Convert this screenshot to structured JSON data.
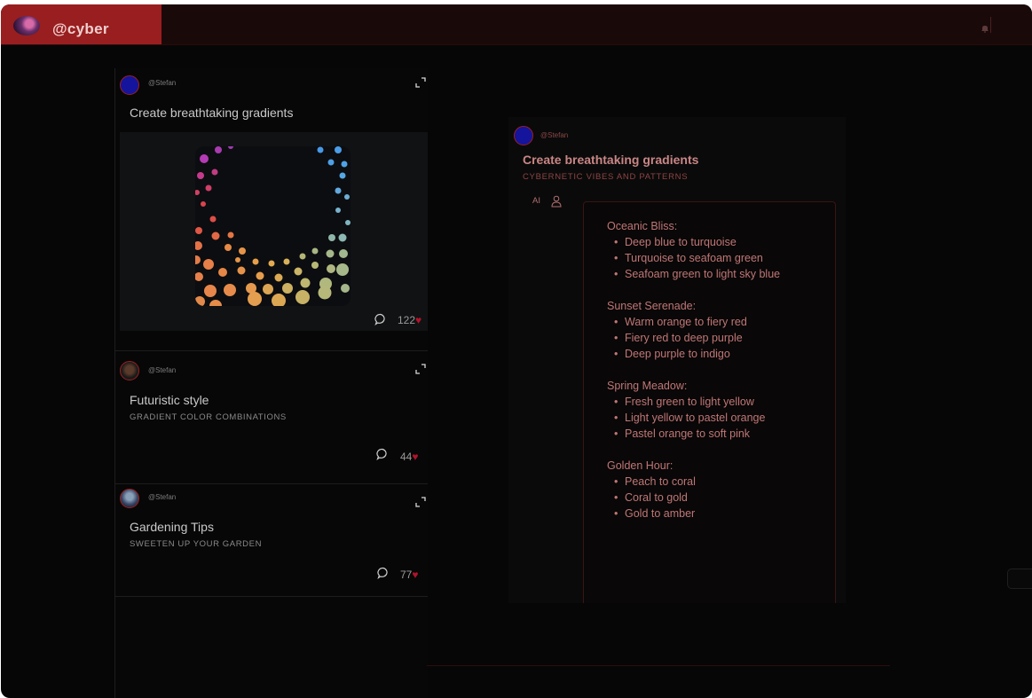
{
  "header": {
    "username": "@cyber"
  },
  "feed": {
    "posts": [
      {
        "handle": "@Stefan",
        "title": "Create breathtaking gradients",
        "subtitle": "",
        "comments_icon": "comment-icon",
        "likes": "122"
      },
      {
        "handle": "@Stefan",
        "title": "Futuristic style",
        "subtitle": "GRADIENT COLOR COMBINATIONS",
        "comments_icon": "comment-icon",
        "likes": "44"
      },
      {
        "handle": "@Stefan",
        "title": "Gardening Tips",
        "subtitle": "SWEETEN UP YOUR GARDEN",
        "comments_icon": "comment-icon",
        "likes": "77"
      }
    ]
  },
  "detail": {
    "handle": "@Stefan",
    "title": "Create breathtaking gradients",
    "subtitle": "CYBERNETIC VIBES AND PATTERNS",
    "ai_label": "AI",
    "sections": [
      {
        "name": "Oceanic Bliss:",
        "items": [
          "Deep blue to turquoise",
          "Turquoise to seafoam green",
          "Seafoam green to light sky blue"
        ]
      },
      {
        "name": "Sunset Serenade:",
        "items": [
          "Warm orange to fiery red",
          "Fiery red to deep purple",
          "Deep purple to indigo"
        ]
      },
      {
        "name": "Spring Meadow:",
        "items": [
          "Fresh green to light yellow",
          "Light yellow to pastel orange",
          "Pastel orange to soft pink"
        ]
      },
      {
        "name": "Golden Hour:",
        "items": [
          "Peach to coral",
          "Coral to gold",
          "Gold to amber"
        ]
      }
    ]
  },
  "colors": {
    "brand": "#991e1f",
    "accent": "#c07676",
    "heart": "#b3132a"
  }
}
